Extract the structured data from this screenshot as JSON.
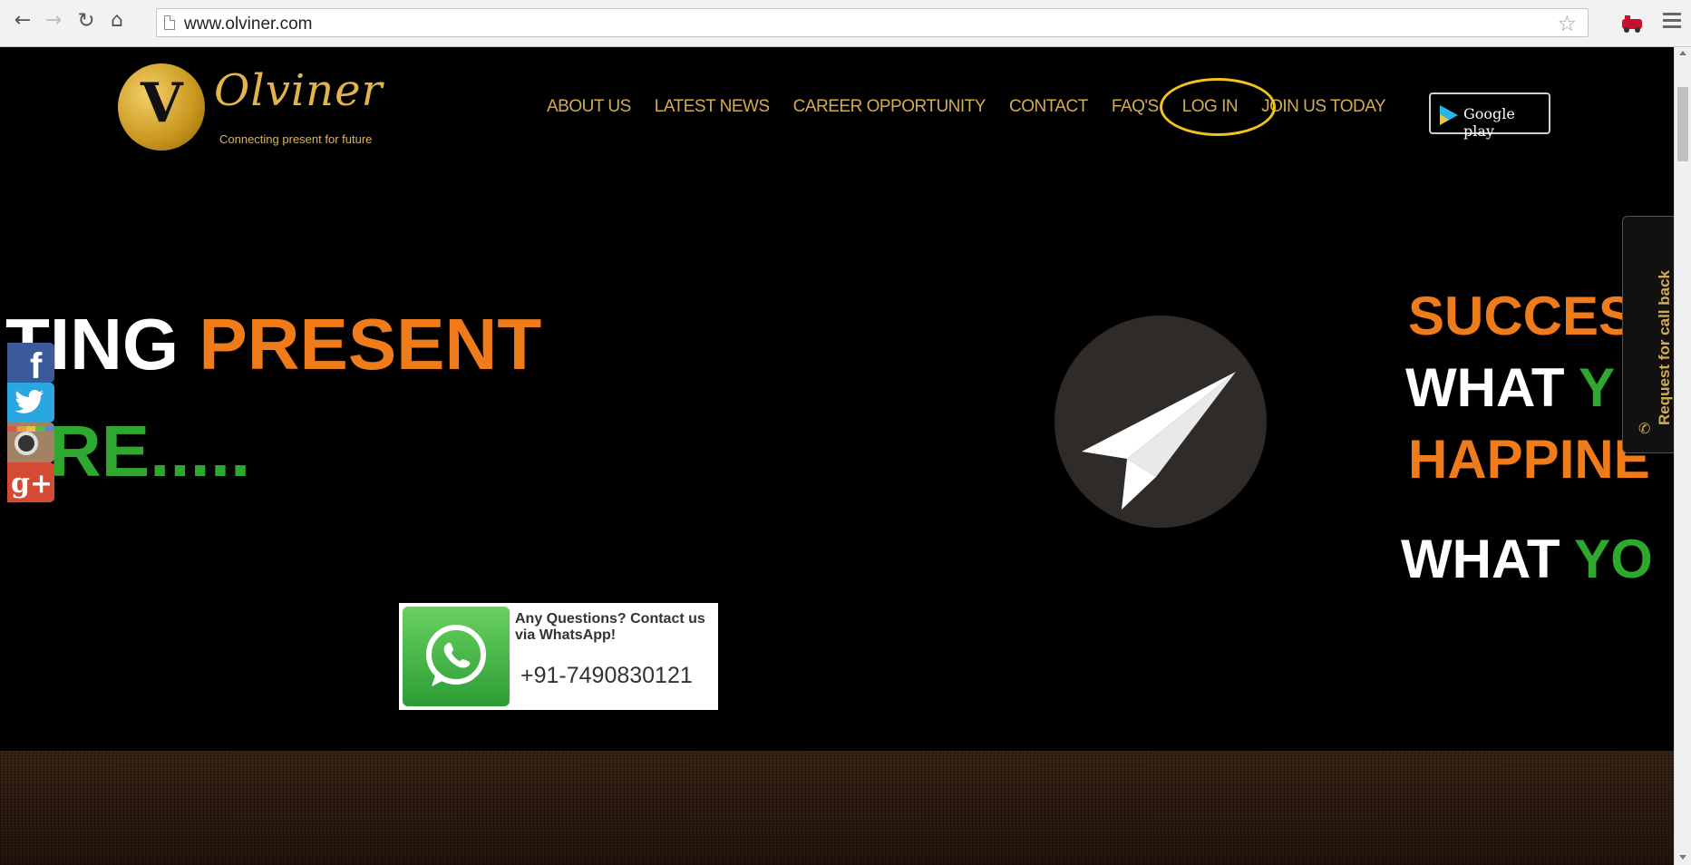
{
  "browser": {
    "url": "www.olviner.com",
    "icons": [
      "back-icon",
      "forward-icon",
      "reload-icon",
      "home-icon",
      "page-icon",
      "star-icon",
      "extension-icon",
      "menu-icon"
    ]
  },
  "site": {
    "logo_letter": "V",
    "logo_name": "Olviner",
    "logo_tagline": "Connecting present for future"
  },
  "nav": {
    "items": [
      "ABOUT US",
      "LATEST NEWS",
      "CAREER OPPORTUNITY",
      "CONTACT",
      "FAQ'S",
      "LOG IN",
      "JOIN US TODAY"
    ],
    "google_play": "Google play"
  },
  "hero": {
    "left_line1_white": "TING ",
    "left_line1_orange": "PRESENT",
    "left_line2": "RE.....",
    "right_line1": "SUCCES",
    "right_line2_white": "WHAT ",
    "right_line2_green": "Y",
    "right_line3": "HAPPINE",
    "right_line4_white": "WHAT ",
    "right_line4_green": "YO"
  },
  "whatsapp": {
    "question": "Any Questions? Contact us via WhatsApp!",
    "phone": "+91-7490830121"
  },
  "callback": {
    "label": "Request for call back"
  },
  "social": [
    "facebook-icon",
    "twitter-icon",
    "instagram-icon",
    "google-plus-icon"
  ],
  "colors": {
    "gold": "#d2ac55",
    "orange": "#ef7b1a",
    "green": "#2fa82f",
    "highlight": "#f0c419"
  }
}
